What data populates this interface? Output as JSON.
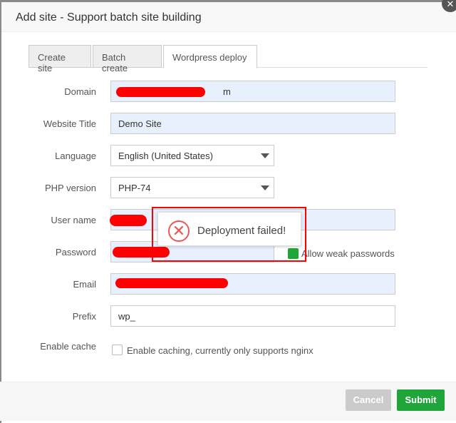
{
  "dialog": {
    "title": "Add site - Support batch site building",
    "close_icon": "close-icon"
  },
  "tabs": [
    {
      "label": "Create site"
    },
    {
      "label": "Batch create"
    },
    {
      "label": "Wordpress deploy",
      "active": true
    }
  ],
  "form": {
    "domain": {
      "label": "Domain",
      "value_visible": "m"
    },
    "website_title": {
      "label": "Website Title",
      "value": "Demo Site"
    },
    "language": {
      "label": "Language",
      "value": "English (United States)"
    },
    "php_version": {
      "label": "PHP version",
      "value": "PHP-74"
    },
    "user_name": {
      "label": "User name"
    },
    "password": {
      "label": "Password",
      "allow_weak": "Allow weak passwords"
    },
    "email": {
      "label": "Email"
    },
    "prefix": {
      "label": "Prefix",
      "value": "wp_"
    },
    "enable_cache": {
      "label": "Enable cache",
      "checkbox_label": "Enable caching, currently only supports nginx"
    }
  },
  "toast": {
    "message": "Deployment failed!",
    "icon": "error-circle-icon"
  },
  "footer": {
    "cancel": "Cancel",
    "submit": "Submit"
  },
  "colors": {
    "submit": "#20a53a",
    "cancel": "#cbcbcb",
    "error": "#e55"
  }
}
